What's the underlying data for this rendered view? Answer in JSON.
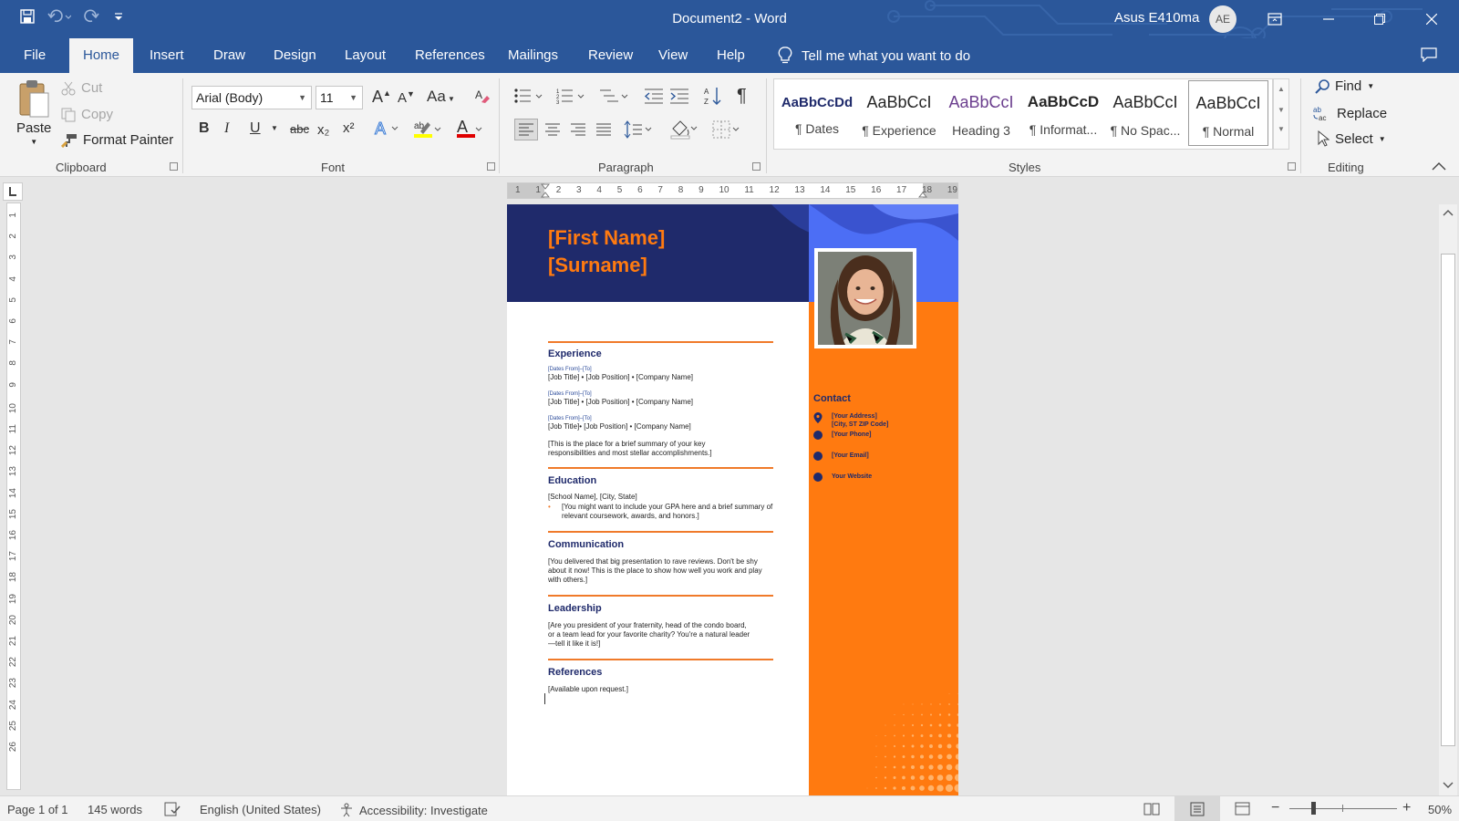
{
  "titlebar": {
    "doc_title": "Document2  -  Word",
    "user_name": "Asus E410ma",
    "user_initials": "AE"
  },
  "menu": {
    "tabs": [
      "File",
      "Home",
      "Insert",
      "Draw",
      "Design",
      "Layout",
      "References",
      "Mailings",
      "Review",
      "View",
      "Help"
    ],
    "active": "Home",
    "tell_me": "Tell me what you want to do"
  },
  "ribbon": {
    "clipboard": {
      "label": "Clipboard",
      "paste": "Paste",
      "cut": "Cut",
      "copy": "Copy",
      "format_painter": "Format Painter"
    },
    "font": {
      "label": "Font",
      "font_name": "Arial (Body)",
      "font_size": "11",
      "bold": "B",
      "italic": "I",
      "underline": "U",
      "strike": "abc",
      "subscript": "x₂",
      "superscript": "x²",
      "grow": "A",
      "shrink": "A",
      "change_case": "Aa"
    },
    "paragraph": {
      "label": "Paragraph"
    },
    "styles": {
      "label": "Styles",
      "items": [
        {
          "sample": "AaBbCcDd",
          "name": "¶ Dates"
        },
        {
          "sample": "AaBbCcI",
          "name": "¶ Experience"
        },
        {
          "sample": "AaBbCcI",
          "name": "Heading 3"
        },
        {
          "sample": "AaBbCcD",
          "name": "¶ Informat..."
        },
        {
          "sample": "AaBbCcI",
          "name": "¶ No Spac..."
        },
        {
          "sample": "AaBbCcI",
          "name": "¶ Normal"
        }
      ]
    },
    "editing": {
      "label": "Editing",
      "find": "Find",
      "replace": "Replace",
      "select": "Select"
    }
  },
  "ruler": {
    "h_labels": [
      "1",
      "1",
      "2",
      "3",
      "4",
      "5",
      "6",
      "7",
      "8",
      "9",
      "10",
      "11",
      "12",
      "13",
      "14",
      "15",
      "16",
      "17",
      "18",
      "19"
    ],
    "v_labels": [
      "1",
      "2",
      "3",
      "4",
      "5",
      "6",
      "7",
      "8",
      "9",
      "10",
      "11",
      "12",
      "13",
      "14",
      "15",
      "16",
      "17",
      "18",
      "19",
      "20",
      "21",
      "22",
      "23",
      "24",
      "25",
      "26"
    ]
  },
  "resume": {
    "first_name": "[First Name]",
    "surname": "[Surname]",
    "experience": {
      "title": "Experience",
      "jobs": [
        {
          "dates": "[Dates From]–[To]",
          "line": "[Job Title] • [Job Position] • [Company Name]"
        },
        {
          "dates": "[Dates From]–[To]",
          "line": "[Job Title] • [Job Position] • [Company Name]"
        },
        {
          "dates": "[Dates From]–[To]",
          "line": "[Job Title]• [Job Position] • [Company Name]"
        }
      ],
      "summary": "[This is the place for a brief summary of your key responsibilities and most stellar accomplishments.]"
    },
    "education": {
      "title": "Education",
      "school": "[School Name], [City, State]",
      "bullet": "[You might want to include your GPA here and a brief summary of relevant coursework, awards, and honors.]"
    },
    "communication": {
      "title": "Communication",
      "text": "[You delivered that big presentation to rave reviews.  Don't be shy about it now!  This is the place to show how well you work and play with others.]"
    },
    "leadership": {
      "title": "Leadership",
      "text": "[Are you president of your fraternity, head of the condo board, or a team lead for your favorite charity? You're a natural leader—tell it like it is!]"
    },
    "references": {
      "title": "References",
      "text": "[Available upon request.]"
    },
    "contact": {
      "title": "Contact",
      "address": "[Your Address]",
      "city": "[City, ST ZIP Code]",
      "phone": "[Your Phone]",
      "email": "[Your Email]",
      "website": "Your Website"
    }
  },
  "status": {
    "page": "Page 1 of 1",
    "words": "145 words",
    "language": "English (United States)",
    "accessibility": "Accessibility: Investigate",
    "zoom": "50%"
  },
  "colors": {
    "brand": "#2b579a",
    "navy": "#1f2a6b",
    "orange": "#ff7a10",
    "blue": "#4c6ef5"
  }
}
